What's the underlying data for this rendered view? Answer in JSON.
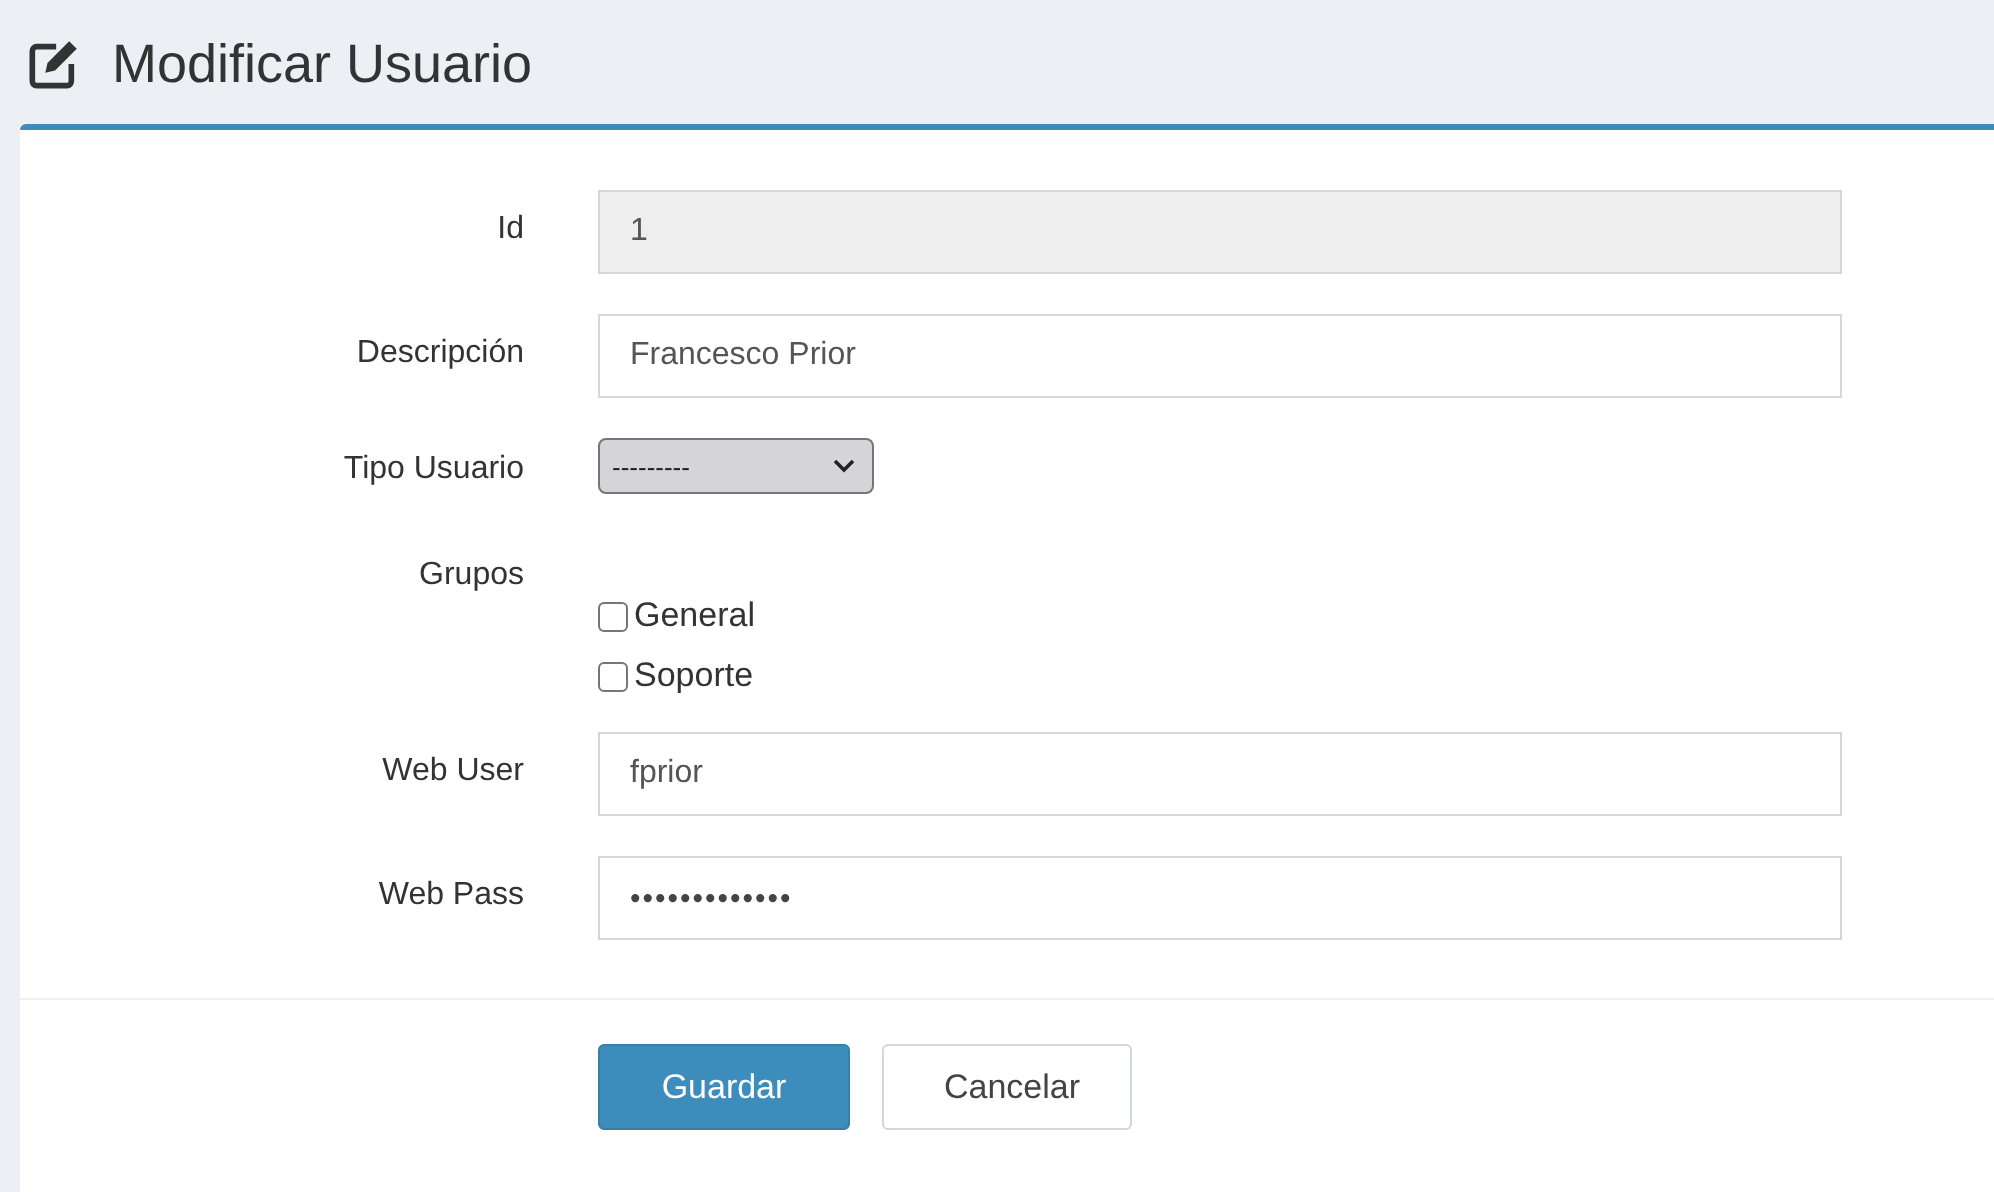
{
  "page": {
    "title": "Modificar Usuario"
  },
  "fields": [
    {
      "kind": "text",
      "label": "Id",
      "value": "1",
      "disabled": true
    },
    {
      "kind": "text",
      "label": "Descripción",
      "value": "Francesco Prior",
      "disabled": false
    },
    {
      "kind": "select",
      "label": "Tipo Usuario",
      "value": "---------"
    },
    {
      "kind": "checkboxes",
      "label": "Grupos",
      "options": [
        {
          "label": "General",
          "checked": false
        },
        {
          "label": "Soporte",
          "checked": false
        }
      ]
    },
    {
      "kind": "text",
      "label": "Web User",
      "value": "fprior",
      "disabled": false
    },
    {
      "kind": "password",
      "label": "Web Pass",
      "value": "•••••••••••••"
    }
  ],
  "buttons": [
    {
      "label": "Guardar",
      "kind": "primary"
    },
    {
      "label": "Cancelar",
      "kind": "default"
    }
  ]
}
